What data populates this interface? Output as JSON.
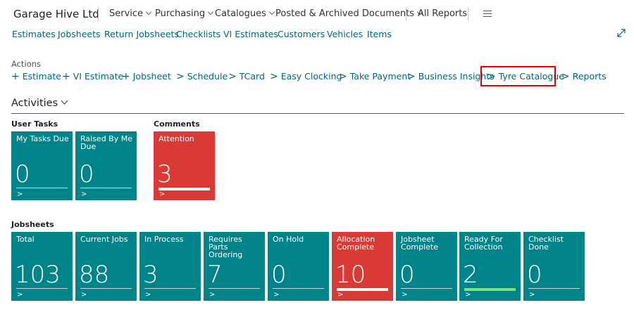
{
  "header": {
    "company": "Garage Hive Ltd",
    "menus": [
      "Service",
      "Purchasing",
      "Catalogues",
      "Posted & Archived Documents"
    ],
    "all_reports": "All Reports"
  },
  "nav": [
    "Estimates",
    "Jobsheets",
    "Return Jobsheets",
    "Checklists",
    "VI Estimates",
    "Customers",
    "Vehicles",
    "Items"
  ],
  "actions": {
    "label": "Actions",
    "items": [
      {
        "glyph": "+",
        "label": "Estimate"
      },
      {
        "glyph": "+",
        "label": "VI Estimate"
      },
      {
        "glyph": "+",
        "label": "Jobsheet"
      },
      {
        "glyph": ">",
        "label": "Schedule"
      },
      {
        "glyph": ">",
        "label": "TCard"
      },
      {
        "glyph": ">",
        "label": "Easy Clocking"
      },
      {
        "glyph": ">",
        "label": "Take Payment"
      },
      {
        "glyph": ">",
        "label": "Business Insights"
      },
      {
        "glyph": ">",
        "label": "Tyre Catalogue"
      },
      {
        "glyph": ">",
        "label": "Reports"
      }
    ]
  },
  "activities": {
    "title": "Activities",
    "user_tasks": {
      "label": "User Tasks",
      "tiles": [
        {
          "label": "My Tasks Due",
          "value": "0",
          "arrow": ">"
        },
        {
          "label": "Raised By Me Due",
          "value": "0",
          "arrow": ">"
        }
      ]
    },
    "comments": {
      "label": "Comments",
      "tiles": [
        {
          "label": "Attention",
          "value": "3",
          "arrow": ">"
        }
      ]
    },
    "jobsheets": {
      "label": "Jobsheets",
      "tiles": [
        {
          "label": "Total",
          "value": "103",
          "arrow": ">"
        },
        {
          "label": "Current Jobs",
          "value": "88",
          "arrow": ">"
        },
        {
          "label": "In Process",
          "value": "3",
          "arrow": ">"
        },
        {
          "label": "Requires Parts Ordering",
          "value": "7",
          "arrow": ">"
        },
        {
          "label": "On Hold",
          "value": "0",
          "arrow": ">"
        },
        {
          "label": "Allocation Complete",
          "value": "10",
          "arrow": ">"
        },
        {
          "label": "Jobsheet Complete",
          "value": "0",
          "arrow": ">"
        },
        {
          "label": "Ready For Collection",
          "value": "2",
          "arrow": ">"
        },
        {
          "label": "Checklist Done",
          "value": "0",
          "arrow": ">"
        }
      ]
    }
  },
  "colors": {
    "accent": "#00667a",
    "tile_teal": "#008489",
    "tile_red": "#d93a35",
    "highlight": "#e00000",
    "bar_green": "#7ee07a"
  }
}
